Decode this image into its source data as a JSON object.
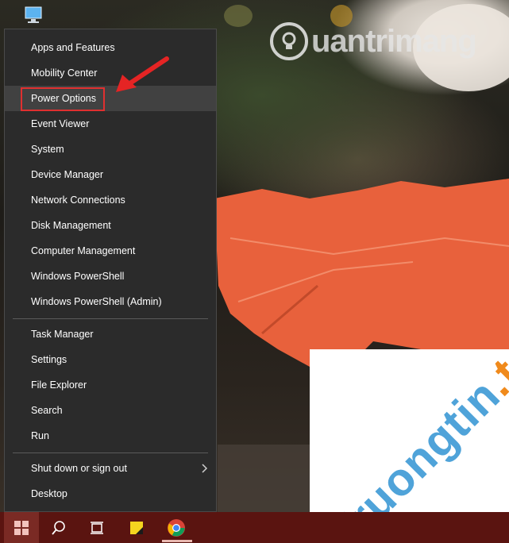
{
  "menu": {
    "items": [
      {
        "label": "Apps and Features"
      },
      {
        "label": "Mobility Center"
      },
      {
        "label": "Power Options"
      },
      {
        "label": "Event Viewer"
      },
      {
        "label": "System"
      },
      {
        "label": "Device Manager"
      },
      {
        "label": "Network Connections"
      },
      {
        "label": "Disk Management"
      },
      {
        "label": "Computer Management"
      },
      {
        "label": "Windows PowerShell"
      },
      {
        "label": "Windows PowerShell (Admin)"
      },
      {
        "label": "Task Manager"
      },
      {
        "label": "Settings"
      },
      {
        "label": "File Explorer"
      },
      {
        "label": "Search"
      },
      {
        "label": "Run"
      },
      {
        "label": "Shut down or sign out"
      },
      {
        "label": "Desktop"
      }
    ],
    "highlighted_item": "Power Options"
  },
  "watermarks": {
    "top_brand": "uantrimang",
    "bottom_part1": "Truongtin",
    "bottom_part2": ".top"
  },
  "colors": {
    "menu_bg": "#2b2b2b",
    "menu_hover": "#414141",
    "highlight_box": "#e03030",
    "taskbar_bg": "#5a1410",
    "watermark_blue": "#4fa3d9",
    "watermark_orange": "#f08a1c"
  },
  "taskbar": {
    "icons": [
      "windows-start-icon",
      "search-icon",
      "task-view-icon",
      "sticky-notes-icon",
      "chrome-icon"
    ]
  }
}
